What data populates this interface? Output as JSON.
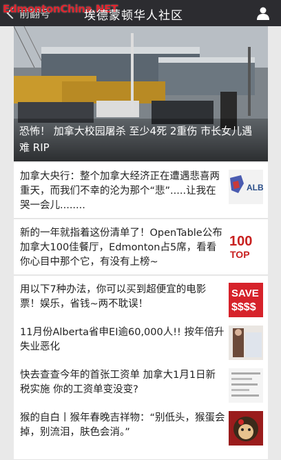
{
  "header": {
    "back_label": "前翻号",
    "title": "埃德蒙顿华人社区",
    "watermark": "EdmontonChina.NET",
    "user_icon": "user-icon"
  },
  "hero": {
    "caption": "恐怖！ 加拿大校园屠杀 至少4死 2重伤 市长女儿遇难 RIP"
  },
  "articles": [
    {
      "text": "加拿大央行：整个加拿大经济正在遭遇悲喜两重天，而我们不幸的沦为那个“悲”.....让我在哭一会儿........",
      "thumb_label": "ALB"
    },
    {
      "text": "新的一年就指着这份清单了！OpenTable公布加拿大100佳餐厅，Edmonton占5席，看看你心目中那个它，有没有上榜~",
      "thumb_label": "100 TOP"
    },
    {
      "text": "用以下7种办法，你可以买到超便宜的电影票！娱乐，省钱~两不耽误！",
      "thumb_label": "SAVE $$$$"
    },
    {
      "text": "11月份Alberta省申EI逾60,000人!! 按年倍升 失业恶化",
      "thumb_label": ""
    },
    {
      "text": "快去查查今年的首张工资单 加拿大1月1日新税实施 你的工资单变没变?",
      "thumb_label": ""
    },
    {
      "text": "猴的自白丨猴年春晚吉祥物：“别低头，猴蛋会掉，别流泪，肤色会消。”",
      "thumb_label": ""
    }
  ]
}
